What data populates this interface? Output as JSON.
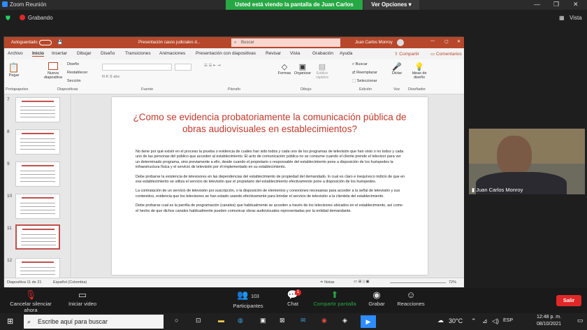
{
  "zoom": {
    "title": "Zoom Reunión",
    "banner": "Usted está viendo la pantalla de Juan Carlos Monroy",
    "view_options": "Ver Opciones",
    "recording": "Grabando",
    "view": "Vista"
  },
  "ppt": {
    "autosave": "Autoguardado",
    "doc_title": "Presentación casos judiciales d...",
    "search": "Buscar",
    "user": "Juan Carlos Monroy",
    "tabs": [
      "Archivo",
      "Inicio",
      "Insertar",
      "Dibujar",
      "Diseño",
      "Transiciones",
      "Animaciones",
      "Presentación con diapositivas",
      "Revisar",
      "Vista",
      "Grabación",
      "Ayuda"
    ],
    "share": "Compartir",
    "comments": "Comentarios",
    "ribbon": {
      "paste": "Pegar",
      "new_slide": "Nueva diapositiva",
      "layout": "Diseño",
      "reset": "Restablecer",
      "section": "Sección",
      "shapes": "Formas",
      "arrange": "Organizar",
      "quick_styles": "Estilos rápidos",
      "find": "Buscar",
      "replace": "Reemplazar",
      "select": "Seleccionar",
      "dictate": "Dictar",
      "design_ideas": "Ideas de diseño",
      "groups": [
        "Portapapeles",
        "Diapositivas",
        "Fuente",
        "Párrafo",
        "Dibujo",
        "Edición",
        "Voz",
        "Diseñador"
      ]
    },
    "thumb_numbers": [
      "7",
      "8",
      "9",
      "10",
      "11",
      "12"
    ],
    "slide": {
      "title": "¿Como se evidencia probatoriamente la comunicación pública de obras audiovisuales en establecimientos?",
      "paragraphs": [
        "No tiene por qué existir en el proceso la prueba o evidencia de cuáles han sido todos y cada uno de los programas de televisión que han visto o no todos y cada uno de las personas del público que acceden al establecimiento. El acto de comunicación pública no se consume cuando el cliente prende el televisor para ver un determinado programa, sino previamente a ello, desde cuando el propietario o responsable del establecimiento pone a disposición de los huéspedes la infraestructura física y el servicio de televisión por él implementado en su establecimiento.",
        "Debe probarse la existencia de televisores en las dependencias del establecimiento de propiedad del demandado, lo cual es claro e inequívoco indicio de que en ese establecimiento se utiliza el servicio de televisión que el propietario del establecimiento efectivamente  pone a disposición de los huéspedes.",
        "La contratación de un servicio de televisión por suscripción, o la disposición de elementos y conexiones necesarias para acceder a la señal de televisión y sus contenidos, evidencia que los televisores se han estado usando efectivamente para brindar el servicio de televisión a la clientela del establecimiento.",
        "Debe probarse cual es la parrilla de programación (canales) que habitualmente se acceden a través de los televisores ubicados en el establecimiento, así como el hecho de que dichos canales habitualmente pueden comunicar obras audiovisuales representadas por la entidad demandante."
      ]
    },
    "status": {
      "slide_count": "Diapositiva 11 de 21",
      "language": "Español (Colombia)",
      "notes": "Notas",
      "zoom": "72%"
    }
  },
  "participant": {
    "name": "Juan Carlos Monroy"
  },
  "toolbar": {
    "unmute": "Cancelar silenciar ahora",
    "video": "Iniciar video",
    "participants": "Participantes",
    "participants_count": "103",
    "chat": "Chat",
    "chat_badge": "1",
    "share": "Compartir pantalla",
    "record": "Grabar",
    "reactions": "Reacciones",
    "leave": "Salir"
  },
  "taskbar": {
    "search_placeholder": "Escribe aquí para buscar",
    "temperature": "30°C",
    "language": "ESP",
    "time": "12:48 p. m.",
    "date": "08/10/2021"
  },
  "colors": {
    "ppt_accent": "#b7472a",
    "title_red": "#c0392b",
    "share_green": "#27a844",
    "leave_red": "#e02828"
  }
}
